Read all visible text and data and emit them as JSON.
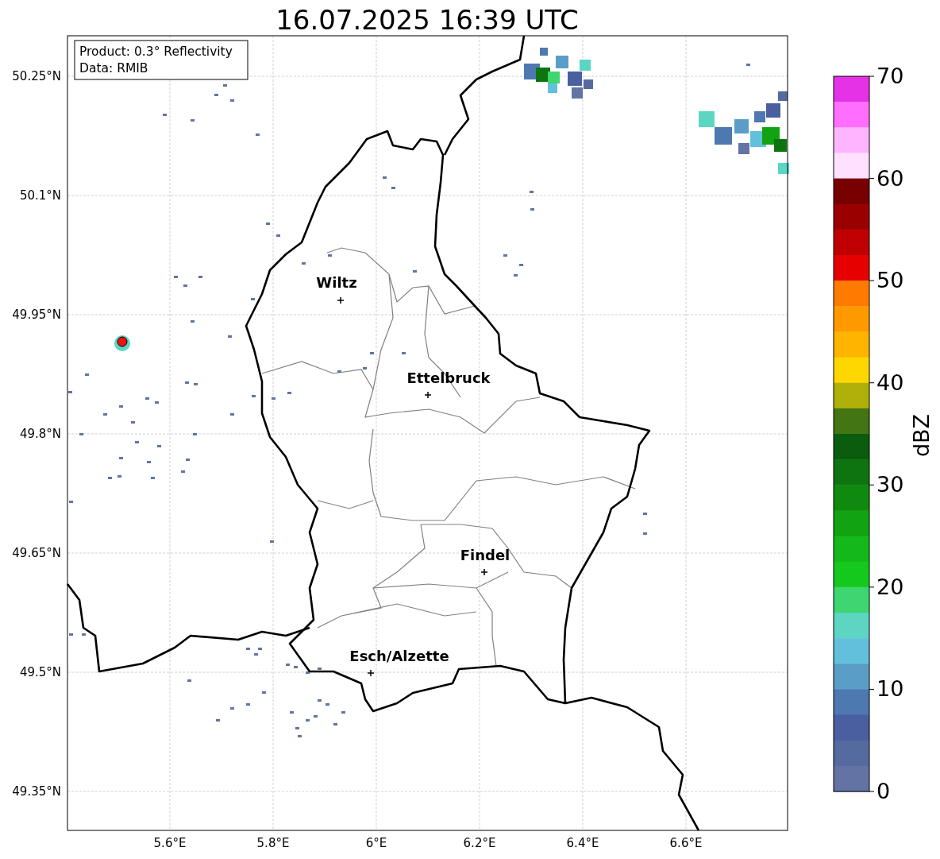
{
  "title": "16.07.2025 16:39 UTC",
  "info_box": [
    "Product: 0.3° Reflectivity",
    "Data: RMIB"
  ],
  "lat_ticks": [
    "50.25°N",
    "50.1°N",
    "49.95°N",
    "49.8°N",
    "49.65°N",
    "49.5°N",
    "49.35°N"
  ],
  "lon_ticks": [
    "5.6°E",
    "5.8°E",
    "6°E",
    "6.2°E",
    "6.4°E",
    "6.6°E"
  ],
  "cities": [
    {
      "name": "Wiltz"
    },
    {
      "name": "Ettelbruck"
    },
    {
      "name": "Findel"
    },
    {
      "name": "Esch/Alzette"
    }
  ],
  "colorbar": {
    "label": "dBZ",
    "ticks": [
      "70",
      "60",
      "50",
      "40",
      "30",
      "20",
      "10",
      "0"
    ],
    "bins": [
      {
        "color": "#e632e6"
      },
      {
        "color": "#ff6eff"
      },
      {
        "color": "#ffb4ff"
      },
      {
        "color": "#ffe0ff"
      },
      {
        "color": "#780000"
      },
      {
        "color": "#9b0000"
      },
      {
        "color": "#c00000"
      },
      {
        "color": "#e60000"
      },
      {
        "color": "#ff7b00"
      },
      {
        "color": "#ff9900"
      },
      {
        "color": "#ffb400"
      },
      {
        "color": "#ffd700"
      },
      {
        "color": "#b0b00a"
      },
      {
        "color": "#437612"
      },
      {
        "color": "#0a5d0c"
      },
      {
        "color": "#0e7410"
      },
      {
        "color": "#10890f"
      },
      {
        "color": "#11a311"
      },
      {
        "color": "#14b81a"
      },
      {
        "color": "#15c91c"
      },
      {
        "color": "#3dd670"
      },
      {
        "color": "#5cd6c2"
      },
      {
        "color": "#63c0dc"
      },
      {
        "color": "#5a9ec8"
      },
      {
        "color": "#4d78b0"
      },
      {
        "color": "#4a5fa0"
      },
      {
        "color": "#556b9f"
      },
      {
        "color": "#6373a3"
      }
    ]
  }
}
